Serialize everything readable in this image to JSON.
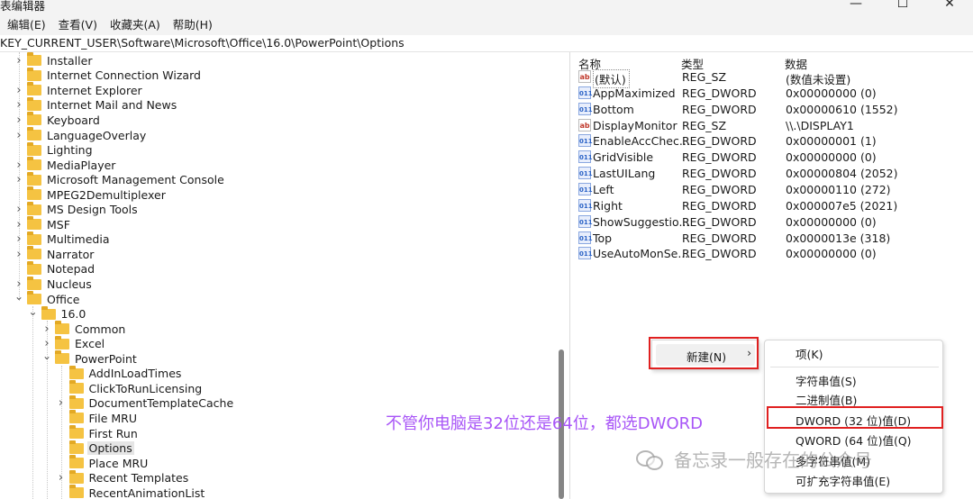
{
  "window": {
    "title": "表编辑器",
    "controls": [
      "—",
      "☐",
      "✕"
    ]
  },
  "menu": [
    "编辑(E)",
    "查看(V)",
    "收藏夹(A)",
    "帮助(H)"
  ],
  "address": "KEY_CURRENT_USER\\Software\\Microsoft\\Office\\16.0\\PowerPoint\\Options",
  "tree": [
    {
      "label": "Installer",
      "level": 0,
      "expander": "collapsed"
    },
    {
      "label": "Internet Connection Wizard",
      "level": 0,
      "expander": "none"
    },
    {
      "label": "Internet Explorer",
      "level": 0,
      "expander": "collapsed"
    },
    {
      "label": "Internet Mail and News",
      "level": 0,
      "expander": "collapsed"
    },
    {
      "label": "Keyboard",
      "level": 0,
      "expander": "collapsed"
    },
    {
      "label": "LanguageOverlay",
      "level": 0,
      "expander": "collapsed"
    },
    {
      "label": "Lighting",
      "level": 0,
      "expander": "none"
    },
    {
      "label": "MediaPlayer",
      "level": 0,
      "expander": "collapsed"
    },
    {
      "label": "Microsoft Management Console",
      "level": 0,
      "expander": "collapsed"
    },
    {
      "label": "MPEG2Demultiplexer",
      "level": 0,
      "expander": "none"
    },
    {
      "label": "MS Design Tools",
      "level": 0,
      "expander": "collapsed"
    },
    {
      "label": "MSF",
      "level": 0,
      "expander": "collapsed"
    },
    {
      "label": "Multimedia",
      "level": 0,
      "expander": "collapsed"
    },
    {
      "label": "Narrator",
      "level": 0,
      "expander": "collapsed"
    },
    {
      "label": "Notepad",
      "level": 0,
      "expander": "none"
    },
    {
      "label": "Nucleus",
      "level": 0,
      "expander": "collapsed"
    },
    {
      "label": "Office",
      "level": 0,
      "expander": "expanded"
    },
    {
      "label": "16.0",
      "level": 1,
      "expander": "expanded"
    },
    {
      "label": "Common",
      "level": 2,
      "expander": "collapsed"
    },
    {
      "label": "Excel",
      "level": 2,
      "expander": "collapsed"
    },
    {
      "label": "PowerPoint",
      "level": 2,
      "expander": "expanded"
    },
    {
      "label": "AddInLoadTimes",
      "level": 3,
      "expander": "none"
    },
    {
      "label": "ClickToRunLicensing",
      "level": 3,
      "expander": "none"
    },
    {
      "label": "DocumentTemplateCache",
      "level": 3,
      "expander": "collapsed"
    },
    {
      "label": "File MRU",
      "level": 3,
      "expander": "none"
    },
    {
      "label": "First Run",
      "level": 3,
      "expander": "none"
    },
    {
      "label": "Options",
      "level": 3,
      "expander": "none",
      "selected": true
    },
    {
      "label": "Place MRU",
      "level": 3,
      "expander": "none"
    },
    {
      "label": "Recent Templates",
      "level": 3,
      "expander": "collapsed"
    },
    {
      "label": "RecentAnimationList",
      "level": 3,
      "expander": "none"
    }
  ],
  "values": {
    "headers": {
      "name": "名称",
      "type": "类型",
      "data": "数据"
    },
    "rows": [
      {
        "icon": "string-value-icon",
        "name": "(默认)",
        "type": "REG_SZ",
        "data": "(数值未设置)"
      },
      {
        "icon": "dword-value-icon",
        "name": "AppMaximized",
        "type": "REG_DWORD",
        "data": "0x00000000 (0)"
      },
      {
        "icon": "dword-value-icon",
        "name": "Bottom",
        "type": "REG_DWORD",
        "data": "0x00000610 (1552)"
      },
      {
        "icon": "string-value-icon",
        "name": "DisplayMonitor",
        "type": "REG_SZ",
        "data": "\\\\.\\DISPLAY1"
      },
      {
        "icon": "dword-value-icon",
        "name": "EnableAccChec...",
        "type": "REG_DWORD",
        "data": "0x00000001 (1)"
      },
      {
        "icon": "dword-value-icon",
        "name": "GridVisible",
        "type": "REG_DWORD",
        "data": "0x00000000 (0)"
      },
      {
        "icon": "dword-value-icon",
        "name": "LastUILang",
        "type": "REG_DWORD",
        "data": "0x00000804 (2052)"
      },
      {
        "icon": "dword-value-icon",
        "name": "Left",
        "type": "REG_DWORD",
        "data": "0x00000110 (272)"
      },
      {
        "icon": "dword-value-icon",
        "name": "Right",
        "type": "REG_DWORD",
        "data": "0x000007e5 (2021)"
      },
      {
        "icon": "dword-value-icon",
        "name": "ShowSuggestio...",
        "type": "REG_DWORD",
        "data": "0x00000000 (0)"
      },
      {
        "icon": "dword-value-icon",
        "name": "Top",
        "type": "REG_DWORD",
        "data": "0x0000013e (318)"
      },
      {
        "icon": "dword-value-icon",
        "name": "UseAutoMonSe...",
        "type": "REG_DWORD",
        "data": "0x00000000 (0)"
      }
    ]
  },
  "context_menu": {
    "new_label": "新建(N)",
    "submenu": {
      "key": "项(K)",
      "string": "字符串值(S)",
      "binary": "二进制值(B)",
      "dword": "DWORD (32 位)值(D)",
      "qword": "QWORD (64 位)值(Q)",
      "multi_string": "多字符串值(M)",
      "expand_string": "可扩充字符串值(E)"
    }
  },
  "annotation": "不管你电脑是32位还是64位，都选DWORD",
  "watermark": "备忘录一般存在的公众号",
  "colors": {
    "highlight_box": "#e02020",
    "annotation": "#a855f7",
    "folder": "#f5c342"
  }
}
